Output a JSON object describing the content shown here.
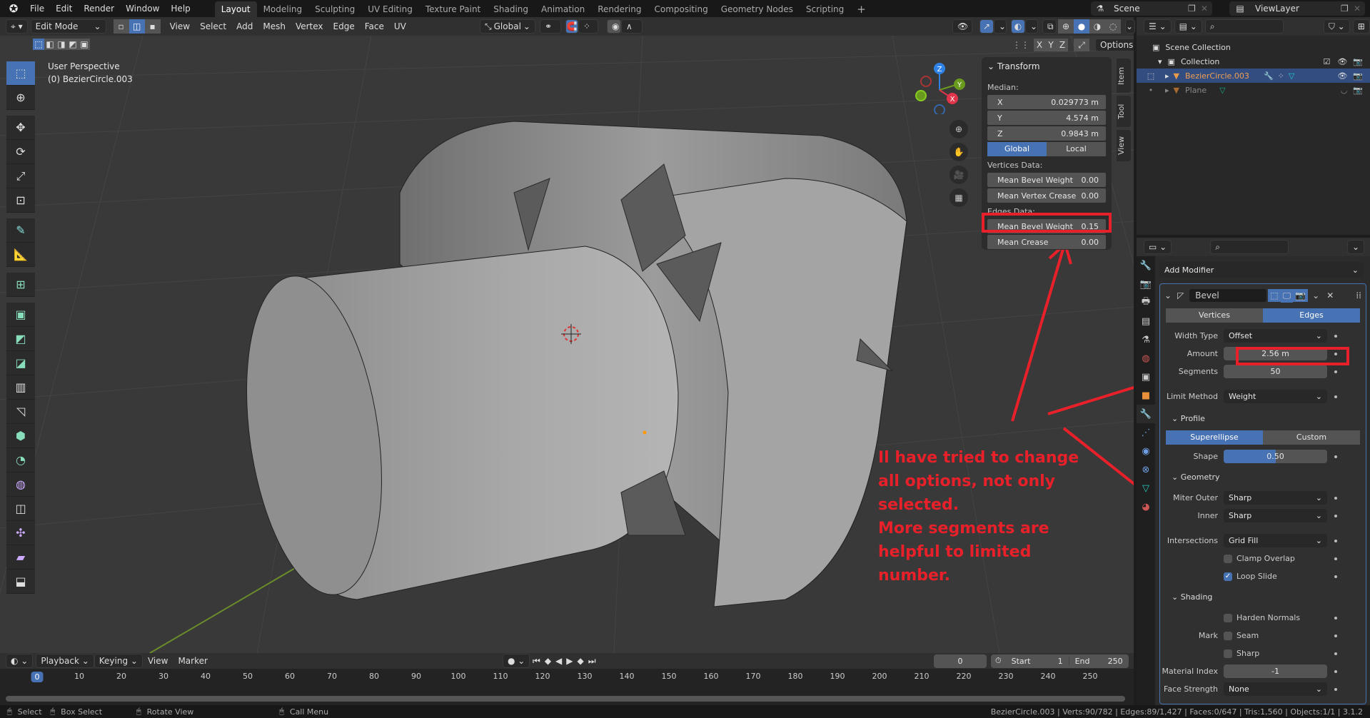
{
  "topbar": {
    "menus": [
      "File",
      "Edit",
      "Render",
      "Window",
      "Help"
    ],
    "workspaces": [
      "Layout",
      "Modeling",
      "Sculpting",
      "UV Editing",
      "Texture Paint",
      "Shading",
      "Animation",
      "Rendering",
      "Compositing",
      "Geometry Nodes",
      "Scripting"
    ],
    "active_workspace": "Layout",
    "add_workspace": "+",
    "scene": "Scene",
    "view_layer": "ViewLayer"
  },
  "vp_header": {
    "mode": "Edit Mode",
    "menus": [
      "View",
      "Select",
      "Add",
      "Mesh",
      "Vertex",
      "Edge",
      "Face",
      "UV"
    ],
    "orientation": "Global",
    "axes": [
      "X",
      "Y",
      "Z"
    ],
    "options": "Options"
  },
  "viewport": {
    "view_name": "User Perspective",
    "object_label": "(0) BezierCircle.003",
    "gizmo": {
      "x": "X",
      "y": "Y",
      "z": "Z"
    }
  },
  "npanel": {
    "tabs": [
      "Item",
      "Tool",
      "View"
    ],
    "title": "Transform",
    "median_label": "Median:",
    "median": [
      {
        "axis": "X",
        "value": "0.029773 m"
      },
      {
        "axis": "Y",
        "value": "4.574 m"
      },
      {
        "axis": "Z",
        "value": "0.9843 m"
      }
    ],
    "space": [
      "Global",
      "Local"
    ],
    "active_space": "Global",
    "vertices_label": "Vertices Data:",
    "vertices": [
      {
        "label": "Mean Bevel Weight",
        "value": "0.00"
      },
      {
        "label": "Mean Vertex Crease",
        "value": "0.00"
      }
    ],
    "edges_label": "Edges Data:",
    "edges": [
      {
        "label": "Mean Bevel Weight",
        "value": "0.15"
      },
      {
        "label": "Mean Crease",
        "value": "0.00"
      }
    ]
  },
  "outliner": {
    "scene_collection": "Scene Collection",
    "collection": "Collection",
    "items": [
      {
        "name": "BezierCircle.003",
        "selected": true
      },
      {
        "name": "Plane",
        "selected": false
      }
    ]
  },
  "properties": {
    "add_modifier": "Add Modifier",
    "modifier_name": "Bevel",
    "affect": [
      "Vertices",
      "Edges"
    ],
    "active_affect": "Edges",
    "width_type_label": "Width Type",
    "width_type": "Offset",
    "amount_label": "Amount",
    "amount": "2.56 m",
    "segments_label": "Segments",
    "segments": "50",
    "limit_method_label": "Limit Method",
    "limit_method": "Weight",
    "profile_label": "Profile",
    "profile_types": [
      "Superellipse",
      "Custom"
    ],
    "active_profile": "Superellipse",
    "shape_label": "Shape",
    "shape": "0.50",
    "shape_fraction": 0.5,
    "geometry_label": "Geometry",
    "miter_outer_label": "Miter Outer",
    "miter_outer": "Sharp",
    "inner_label": "Inner",
    "inner": "Sharp",
    "intersections_label": "Intersections",
    "intersections": "Grid Fill",
    "clamp_overlap": "Clamp Overlap",
    "clamp_overlap_checked": false,
    "loop_slide": "Loop Slide",
    "loop_slide_checked": true,
    "shading_label": "Shading",
    "harden_normals": "Harden Normals",
    "mark_label": "Mark",
    "seam": "Seam",
    "sharp": "Sharp",
    "material_index_label": "Material Index",
    "material_index": "-1",
    "face_strength_label": "Face Strength",
    "face_strength": "None"
  },
  "timeline": {
    "menus": [
      "Playback",
      "Keying",
      "View",
      "Marker"
    ],
    "current_frame": "0",
    "start_label": "Start",
    "start": "1",
    "end_label": "End",
    "end": "250",
    "ticks": [
      "0",
      "10",
      "20",
      "30",
      "40",
      "50",
      "60",
      "70",
      "80",
      "90",
      "100",
      "110",
      "120",
      "130",
      "140",
      "150",
      "160",
      "170",
      "180",
      "190",
      "200",
      "210",
      "220",
      "230",
      "240",
      "250"
    ]
  },
  "statusbar": {
    "hints": [
      "Select",
      "Box Select",
      "Rotate View",
      "Call Menu"
    ],
    "stats": "BezierCircle.003 | Verts:90/782 | Edges:89/1,427 | Faces:0/647 | Tris:1,560 | Objects:1/1 | 3.1.2"
  },
  "annotation": {
    "lines": [
      "Il have tried to change",
      "all options, not only",
      "selected.",
      "More segments are",
      "helpful to limited",
      "number."
    ],
    "color": "#e8202a"
  },
  "colors": {
    "accent": "#4772b3",
    "annotation": "#e8202a"
  }
}
